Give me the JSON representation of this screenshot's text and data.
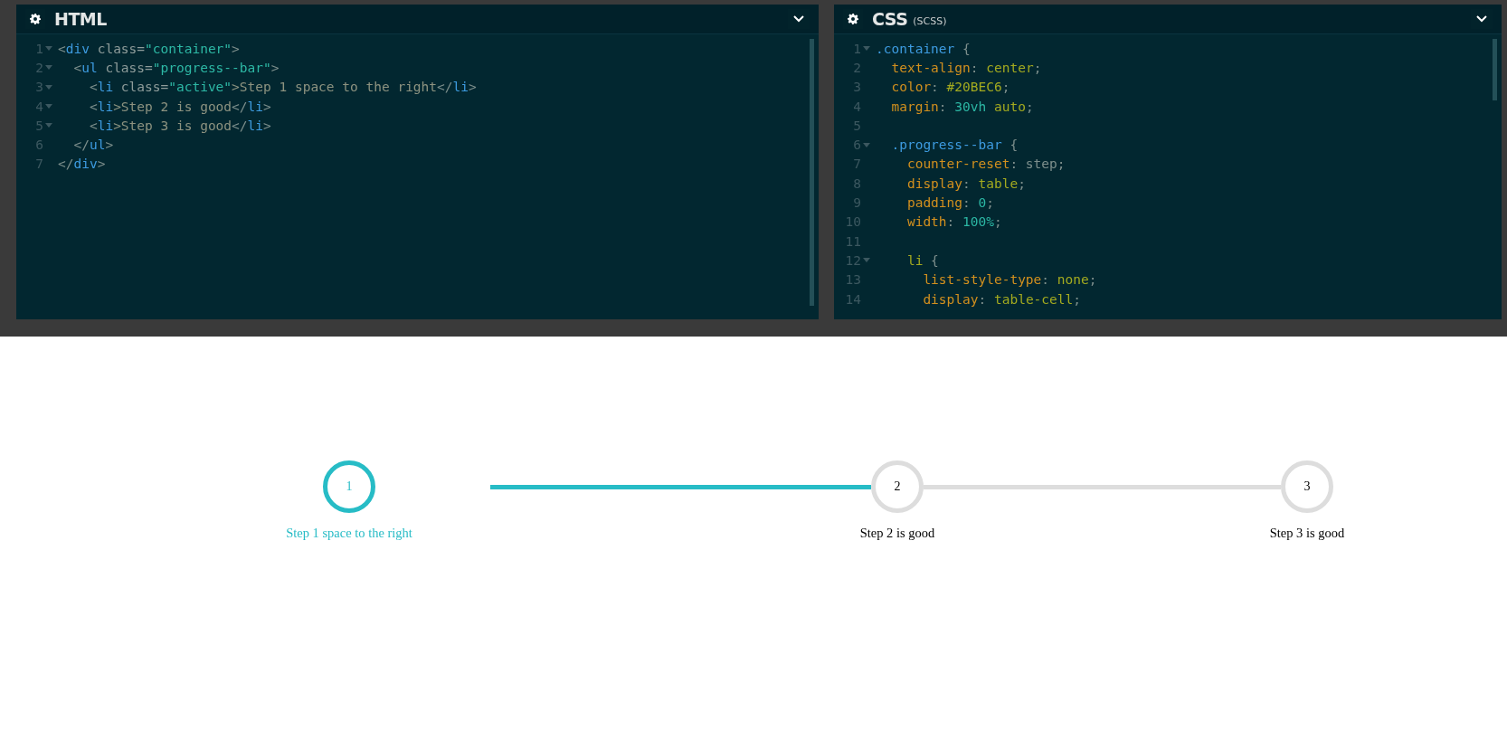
{
  "editors": [
    {
      "title": "HTML",
      "lines": [
        {
          "number": "1",
          "foldable": true,
          "tokens": [
            {
              "text": "<",
              "kind": "punct"
            },
            {
              "text": "div",
              "kind": "tag"
            },
            {
              "text": " class=",
              "kind": "attr"
            },
            {
              "text": "\"container\"",
              "kind": "string"
            },
            {
              "text": ">",
              "kind": "punct"
            }
          ]
        },
        {
          "number": "2",
          "foldable": true,
          "tokens": [
            {
              "text": "  <",
              "kind": "punct"
            },
            {
              "text": "ul",
              "kind": "tag"
            },
            {
              "text": " class=",
              "kind": "attr"
            },
            {
              "text": "\"progress--bar\"",
              "kind": "string"
            },
            {
              "text": ">",
              "kind": "punct"
            }
          ]
        },
        {
          "number": "3",
          "foldable": true,
          "tokens": [
            {
              "text": "    <",
              "kind": "punct"
            },
            {
              "text": "li",
              "kind": "tag"
            },
            {
              "text": " class=",
              "kind": "attr"
            },
            {
              "text": "\"active\"",
              "kind": "string"
            },
            {
              "text": ">Step 1 space to the right",
              "kind": "text"
            },
            {
              "text": "</",
              "kind": "punct"
            },
            {
              "text": "li",
              "kind": "tag"
            },
            {
              "text": ">",
              "kind": "punct"
            }
          ]
        },
        {
          "number": "4",
          "foldable": true,
          "tokens": [
            {
              "text": "    <",
              "kind": "punct"
            },
            {
              "text": "li",
              "kind": "tag"
            },
            {
              "text": ">Step 2 is good",
              "kind": "text"
            },
            {
              "text": "</",
              "kind": "punct"
            },
            {
              "text": "li",
              "kind": "tag"
            },
            {
              "text": ">",
              "kind": "punct"
            }
          ]
        },
        {
          "number": "5",
          "foldable": true,
          "tokens": [
            {
              "text": "    <",
              "kind": "punct"
            },
            {
              "text": "li",
              "kind": "tag"
            },
            {
              "text": ">Step 3 is good",
              "kind": "text"
            },
            {
              "text": "</",
              "kind": "punct"
            },
            {
              "text": "li",
              "kind": "tag"
            },
            {
              "text": ">",
              "kind": "punct"
            }
          ]
        },
        {
          "number": "6",
          "foldable": false,
          "tokens": [
            {
              "text": "  </",
              "kind": "punct"
            },
            {
              "text": "ul",
              "kind": "tag"
            },
            {
              "text": ">",
              "kind": "punct"
            }
          ]
        },
        {
          "number": "7",
          "foldable": false,
          "tokens": [
            {
              "text": "</",
              "kind": "punct"
            },
            {
              "text": "div",
              "kind": "tag"
            },
            {
              "text": ">",
              "kind": "punct"
            }
          ]
        }
      ]
    },
    {
      "title": "CSS",
      "subtitle": "(SCSS)",
      "lines": [
        {
          "number": "1",
          "foldable": true,
          "tokens": [
            {
              "text": ".container",
              "kind": "selector"
            },
            {
              "text": " {",
              "kind": "punct"
            }
          ]
        },
        {
          "number": "2",
          "foldable": false,
          "tokens": [
            {
              "text": "  text-align",
              "kind": "property"
            },
            {
              "text": ": ",
              "kind": "punct"
            },
            {
              "text": "center",
              "kind": "value"
            },
            {
              "text": ";",
              "kind": "punct"
            }
          ]
        },
        {
          "number": "3",
          "foldable": false,
          "tokens": [
            {
              "text": "  color",
              "kind": "property"
            },
            {
              "text": ": ",
              "kind": "punct"
            },
            {
              "text": "#20BEC6",
              "kind": "value"
            },
            {
              "text": ";",
              "kind": "punct"
            }
          ]
        },
        {
          "number": "4",
          "foldable": false,
          "tokens": [
            {
              "text": "  margin",
              "kind": "property"
            },
            {
              "text": ": ",
              "kind": "punct"
            },
            {
              "text": "30vh",
              "kind": "number"
            },
            {
              "text": " auto",
              "kind": "value"
            },
            {
              "text": ";",
              "kind": "punct"
            }
          ]
        },
        {
          "number": "5",
          "foldable": false
        },
        {
          "number": "6",
          "foldable": true,
          "tokens": [
            {
              "text": "  .progress--bar",
              "kind": "selector"
            },
            {
              "text": " {",
              "kind": "punct"
            }
          ]
        },
        {
          "number": "7",
          "foldable": false,
          "tokens": [
            {
              "text": "    counter-reset",
              "kind": "property"
            },
            {
              "text": ": step;",
              "kind": "punct"
            }
          ]
        },
        {
          "number": "8",
          "foldable": false,
          "tokens": [
            {
              "text": "    display",
              "kind": "property"
            },
            {
              "text": ": ",
              "kind": "punct"
            },
            {
              "text": "table",
              "kind": "value"
            },
            {
              "text": ";",
              "kind": "punct"
            }
          ]
        },
        {
          "number": "9",
          "foldable": false,
          "tokens": [
            {
              "text": "    padding",
              "kind": "property"
            },
            {
              "text": ": ",
              "kind": "punct"
            },
            {
              "text": "0",
              "kind": "number"
            },
            {
              "text": ";",
              "kind": "punct"
            }
          ]
        },
        {
          "number": "10",
          "foldable": false,
          "tokens": [
            {
              "text": "    width",
              "kind": "property"
            },
            {
              "text": ": ",
              "kind": "punct"
            },
            {
              "text": "100%",
              "kind": "number"
            },
            {
              "text": ";",
              "kind": "punct"
            }
          ]
        },
        {
          "number": "11",
          "foldable": false
        },
        {
          "number": "12",
          "foldable": true,
          "tokens": [
            {
              "text": "    li",
              "kind": "value"
            },
            {
              "text": " {",
              "kind": "punct"
            }
          ]
        },
        {
          "number": "13",
          "foldable": false,
          "tokens": [
            {
              "text": "      list-style-type",
              "kind": "property"
            },
            {
              "text": ": ",
              "kind": "punct"
            },
            {
              "text": "none",
              "kind": "value"
            },
            {
              "text": ";",
              "kind": "punct"
            }
          ]
        },
        {
          "number": "14",
          "foldable": false,
          "tokens": [
            {
              "text": "      display",
              "kind": "property"
            },
            {
              "text": ": ",
              "kind": "punct"
            },
            {
              "text": "table-cell",
              "kind": "value"
            },
            {
              "text": ";",
              "kind": "punct"
            }
          ]
        }
      ]
    }
  ],
  "steps": [
    {
      "number": "1",
      "label": "Step 1 space to the right",
      "active": true
    },
    {
      "number": "2",
      "label": "Step 2 is good",
      "active": false
    },
    {
      "number": "3",
      "label": "Step 3 is good",
      "active": false
    }
  ]
}
